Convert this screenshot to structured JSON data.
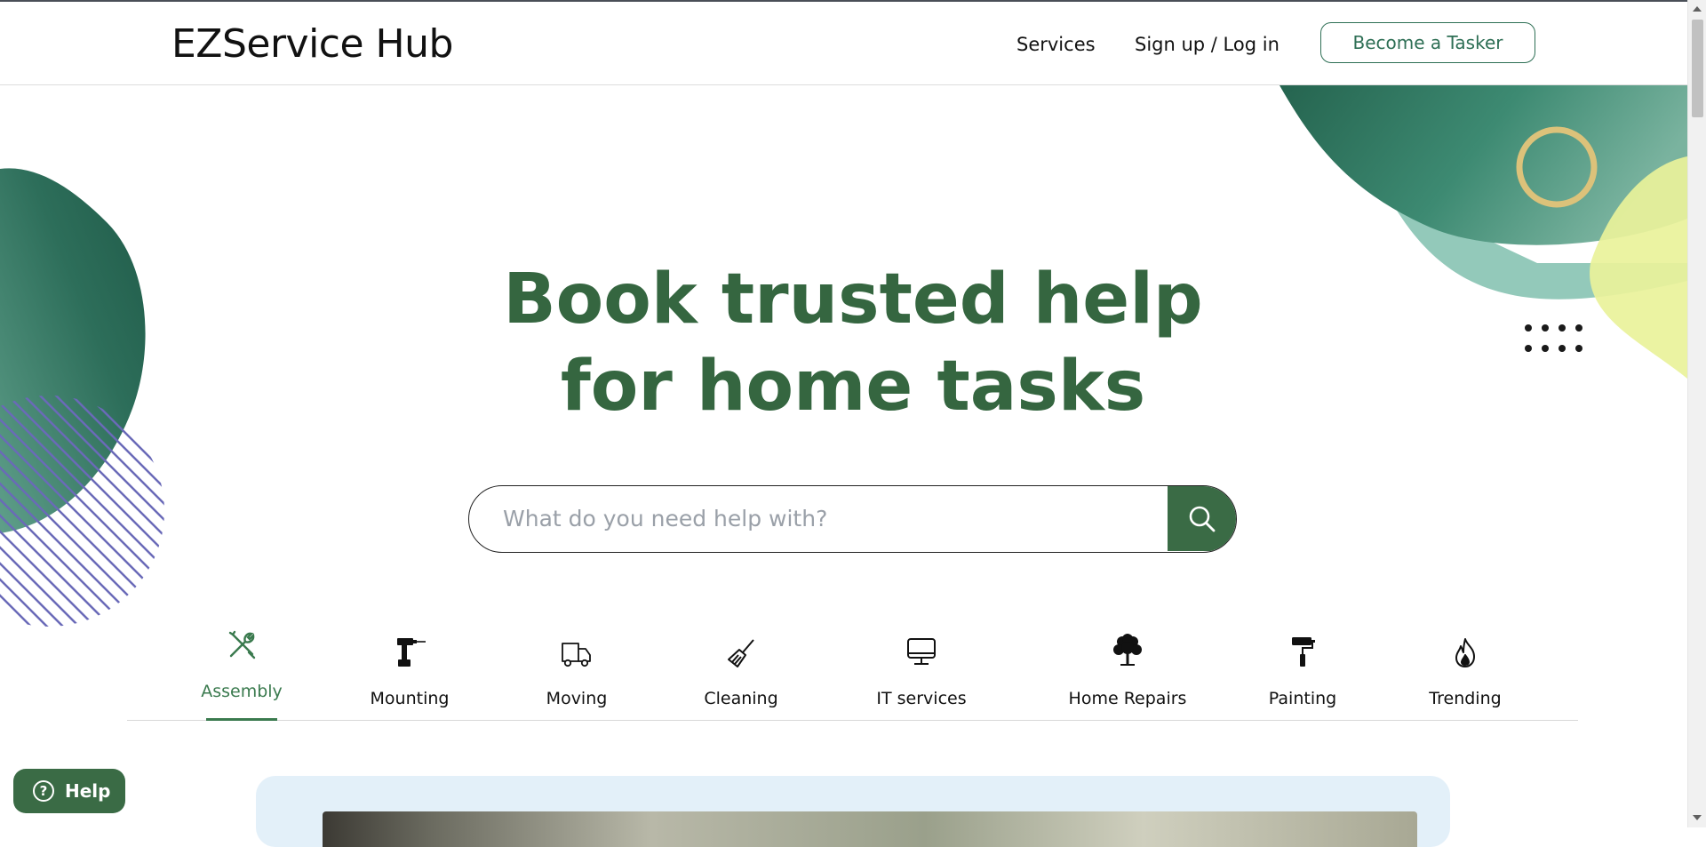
{
  "header": {
    "logo": "EZService Hub",
    "nav": {
      "services": "Services",
      "login": "Sign up / Log in"
    },
    "cta": "Become a Tasker"
  },
  "hero": {
    "title_line1": "Book trusted help",
    "title_line2": "for home tasks"
  },
  "search": {
    "placeholder": "What do you need help with?",
    "value": ""
  },
  "categories": [
    {
      "label": "Assembly",
      "icon": "wrench-screwdriver-icon",
      "active": true
    },
    {
      "label": "Mounting",
      "icon": "drill-icon",
      "active": false
    },
    {
      "label": "Moving",
      "icon": "truck-icon",
      "active": false
    },
    {
      "label": "Cleaning",
      "icon": "broom-icon",
      "active": false
    },
    {
      "label": "IT services",
      "icon": "monitor-icon",
      "active": false
    },
    {
      "label": "Home Repairs",
      "icon": "tree-icon",
      "active": false
    },
    {
      "label": "Painting",
      "icon": "paint-roller-icon",
      "active": false
    },
    {
      "label": "Trending",
      "icon": "flame-icon",
      "active": false
    }
  ],
  "help": {
    "label": "Help"
  },
  "colors": {
    "brand_green": "#356640",
    "accent_green": "#3a7a4e",
    "button_green": "#3a6b45",
    "tasker_border": "#2e6f55",
    "promo_bg": "#e3f0f9"
  }
}
